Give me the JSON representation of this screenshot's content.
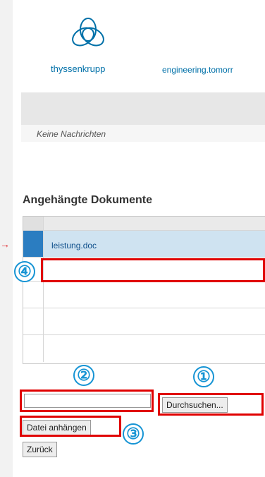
{
  "header": {
    "brand": "thyssenkrupp",
    "tagline": "engineering.tomorr"
  },
  "messages": {
    "empty_text": "Keine Nachrichten"
  },
  "attachments": {
    "heading": "Angehängte Dokumente",
    "rows": [
      "leistung.doc",
      "",
      "",
      "",
      ""
    ]
  },
  "upload": {
    "file_input_value": "",
    "browse_label": "Durchsuchen...",
    "attach_label": "Datei anhängen",
    "back_label": "Zurück"
  },
  "callouts": {
    "c1": "①",
    "c2": "②",
    "c3": "③",
    "c4": "④",
    "arrow": "→"
  },
  "colors": {
    "brand_blue": "#0070a8",
    "selected_row": "#cfe3f1",
    "highlight_red": "#e00000",
    "callout_blue": "#1694d4"
  }
}
